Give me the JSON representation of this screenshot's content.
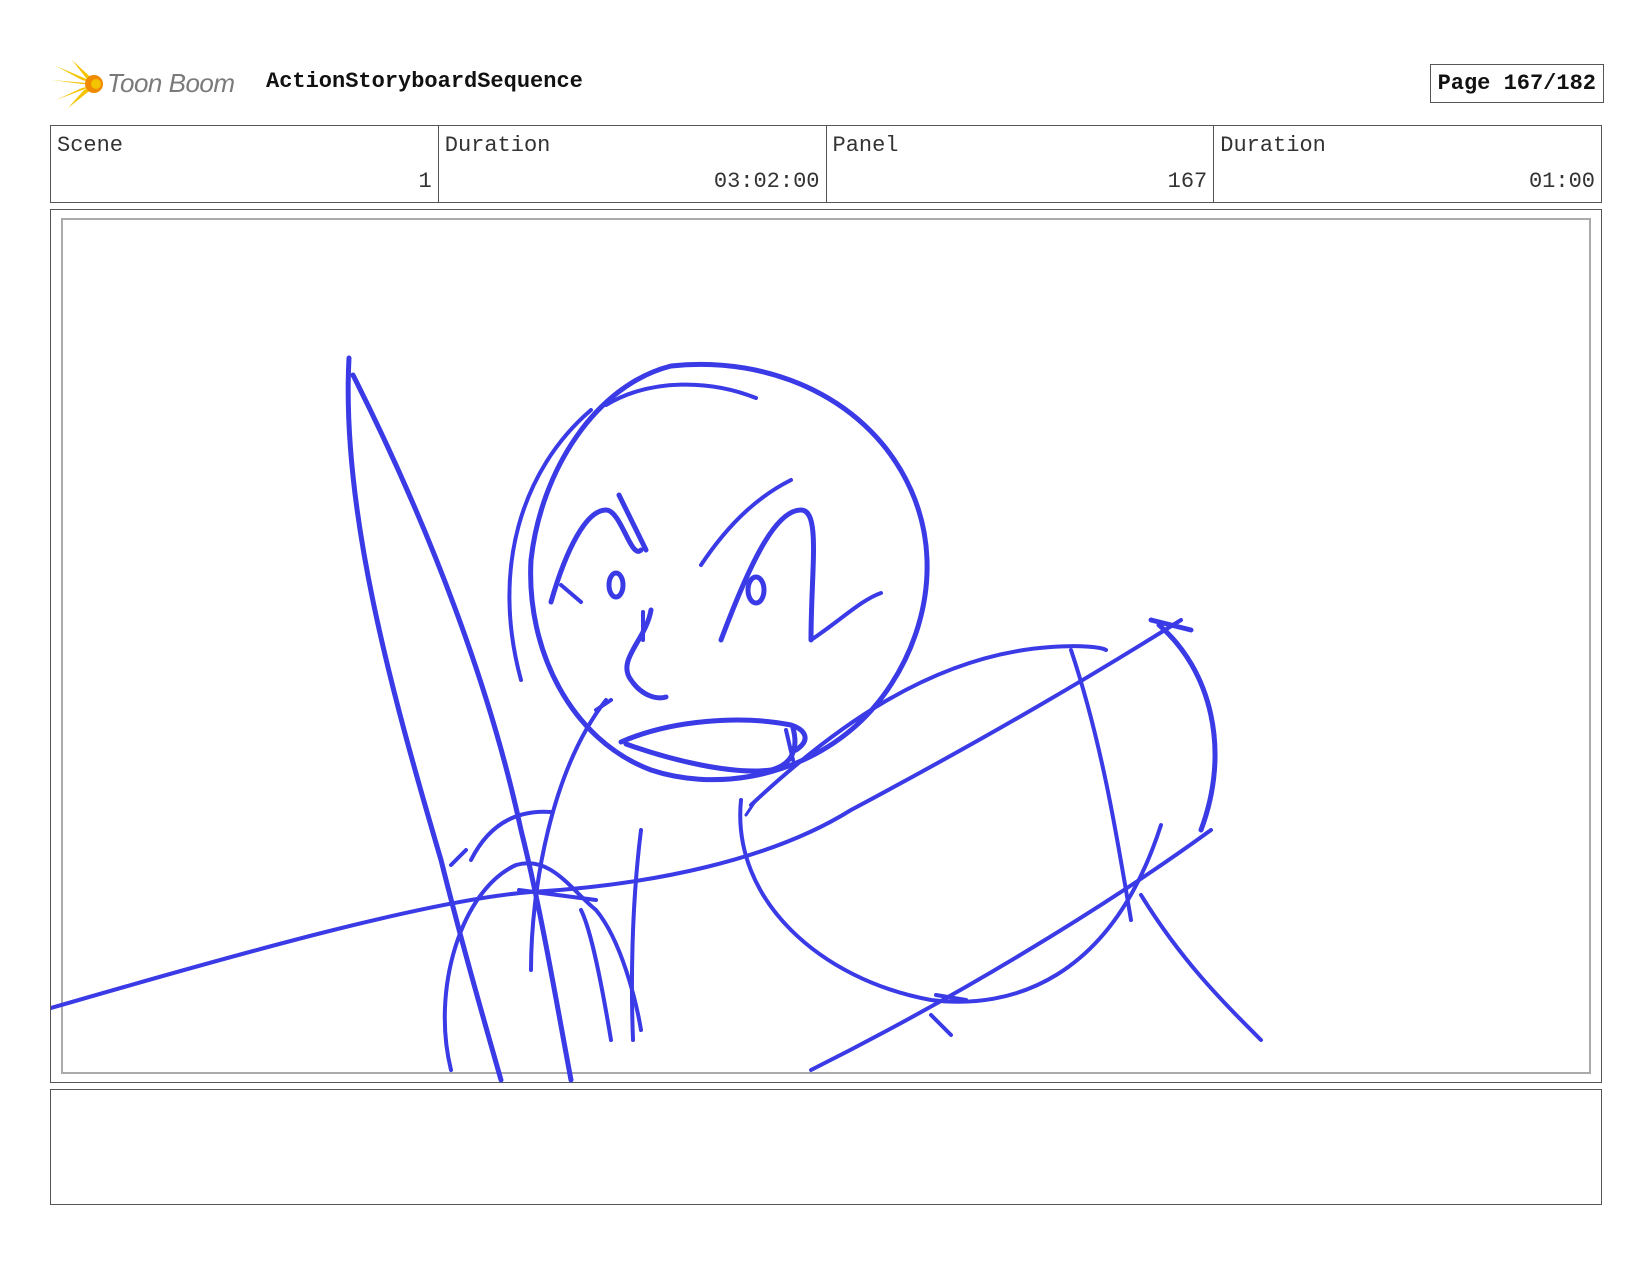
{
  "header": {
    "logo_text": "Toon Boom",
    "project_title": "ActionStoryboardSequence",
    "page_label": "Page 167/182"
  },
  "info": {
    "scene_label": "Scene",
    "scene_value": "1",
    "scene_duration_label": "Duration",
    "scene_duration_value": "03:02:00",
    "panel_label": "Panel",
    "panel_value": "167",
    "panel_duration_label": "Duration",
    "panel_duration_value": "01:00"
  },
  "sketch": {
    "stroke_color": "#3a3ae6"
  },
  "logo": {
    "colors": [
      "#f5c400",
      "#f08a00"
    ]
  }
}
